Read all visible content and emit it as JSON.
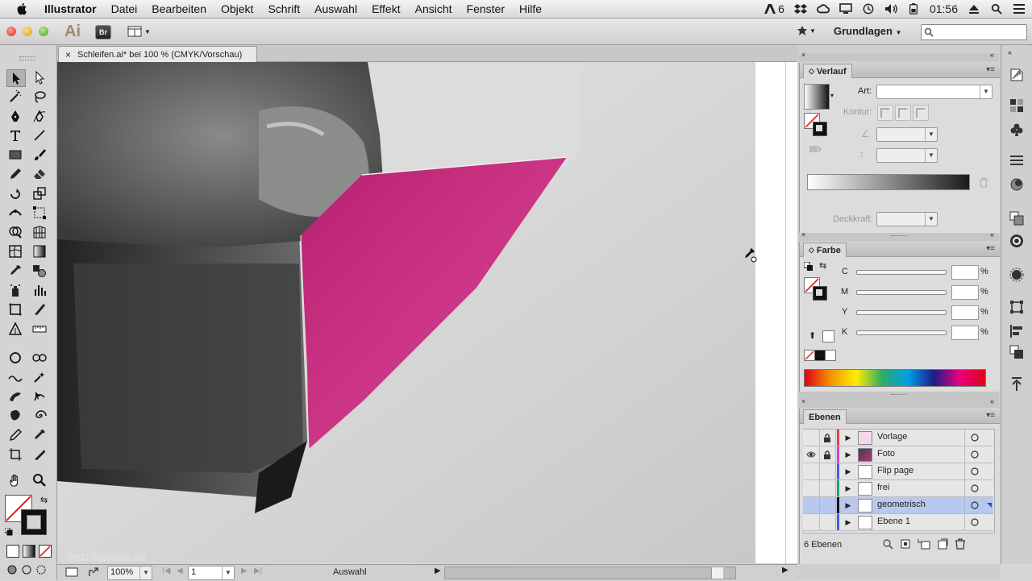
{
  "menubar": {
    "app": "Illustrator",
    "items": [
      "Datei",
      "Bearbeiten",
      "Objekt",
      "Schrift",
      "Auswahl",
      "Effekt",
      "Ansicht",
      "Fenster",
      "Hilfe"
    ],
    "adobe_badge": "6",
    "clock": "01:56"
  },
  "appbar": {
    "logo": "Ai",
    "bridge": "Br",
    "workspace": "Grundlagen"
  },
  "document": {
    "tab_title": "Schleifen.ai* bei 100 % (CMYK/Vorschau)",
    "close": "×",
    "watermark": "PSD-Tutorials.de"
  },
  "statusbar": {
    "zoom": "100%",
    "artboard": "1",
    "tool": "Auswahl"
  },
  "verlauf": {
    "title": "Verlauf",
    "art_label": "Art:",
    "kontur_label": "Kontur:",
    "deckkraft_label": "Deckkraft:"
  },
  "farbe": {
    "title": "Farbe",
    "channels": [
      "C",
      "M",
      "Y",
      "K"
    ],
    "unit": "%"
  },
  "ebenen": {
    "title": "Ebenen",
    "layers": [
      {
        "name": "Vorlage",
        "color": "#e04040"
      },
      {
        "name": "Foto",
        "color": "#d040d0"
      },
      {
        "name": "Flip page",
        "color": "#4060e0"
      },
      {
        "name": "frei",
        "color": "#20a070"
      },
      {
        "name": "geometrisch",
        "color": "#3040d0"
      },
      {
        "name": "Ebene 1",
        "color": "#4060e0"
      }
    ],
    "count": "6 Ebenen"
  },
  "colors": {
    "magenta": "#c8287e",
    "selection": "#b8c8ee"
  }
}
